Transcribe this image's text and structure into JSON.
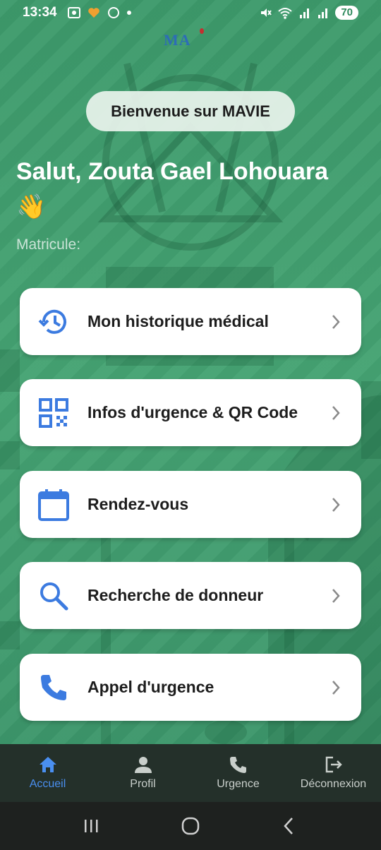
{
  "status_bar": {
    "time": "13:34",
    "battery": "70"
  },
  "logo": {
    "text": "MA"
  },
  "welcome_chip": "Bienvenue sur MAVIE",
  "greeting": {
    "text": "Salut, Zouta Gael Lohouara",
    "emoji": "👋"
  },
  "matricule_label": "Matricule:",
  "menu": [
    {
      "label": "Mon historique médical",
      "icon": "history-icon"
    },
    {
      "label": "Infos d'urgence & QR Code",
      "icon": "qr-code-icon"
    },
    {
      "label": "Rendez-vous",
      "icon": "calendar-icon"
    },
    {
      "label": "Recherche de donneur",
      "icon": "search-icon"
    },
    {
      "label": "Appel d'urgence",
      "icon": "phone-icon"
    }
  ],
  "bottom_nav": [
    {
      "label": "Accueil",
      "icon": "home-icon",
      "active": true
    },
    {
      "label": "Profil",
      "icon": "person-icon",
      "active": false
    },
    {
      "label": "Urgence",
      "icon": "phone-icon",
      "active": false
    },
    {
      "label": "Déconnexion",
      "icon": "logout-icon",
      "active": false
    }
  ],
  "colors": {
    "background": "#3f9a6c",
    "icon_blue": "#3c7be0",
    "nav_active": "#4a8ff0",
    "nav_bg": "#24302a"
  }
}
